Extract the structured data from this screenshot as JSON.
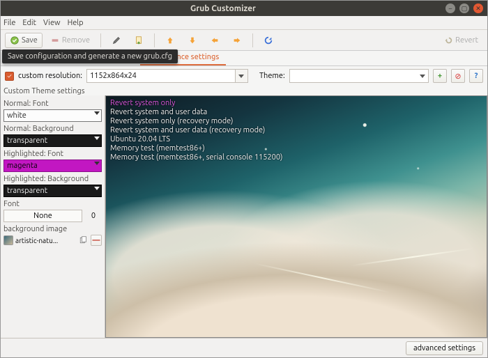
{
  "window": {
    "title": "Grub Customizer"
  },
  "menu": {
    "file": "File",
    "edit": "Edit",
    "view": "View",
    "help": "Help"
  },
  "toolbar": {
    "save_label": "Save",
    "remove_label": "Remove",
    "revert_label": "Revert",
    "tooltip": "Save configuration and generate a new grub.cfg"
  },
  "tabs": {
    "appearance": "Appearance settings"
  },
  "options": {
    "custom_resolution_label": "custom resolution:",
    "resolution_value": "1152x864x24",
    "theme_label": "Theme:",
    "theme_value": ""
  },
  "section_label": "Custom Theme settings",
  "theme_settings": {
    "normal_font_label": "Normal: Font",
    "normal_font_value": "white",
    "normal_bg_label": "Normal: Background",
    "normal_bg_value": "transparent",
    "hl_font_label": "Highlighted: Font",
    "hl_font_value": "magenta",
    "hl_bg_label": "Highlighted: Background",
    "hl_bg_value": "transparent",
    "font_label": "Font",
    "font_name": "None",
    "font_size": "0",
    "bg_image_label": "background image",
    "bg_image_name": "artistic-natu..."
  },
  "boot_entries": [
    "Revert system only",
    "Revert system and user data",
    "Revert system only (recovery mode)",
    "Revert system and user data (recovery mode)",
    "Ubuntu 20.04 LTS",
    "Memory test (memtest86+)",
    "Memory test (memtest86+, serial console 115200)"
  ],
  "footer": {
    "advanced": "advanced settings"
  }
}
